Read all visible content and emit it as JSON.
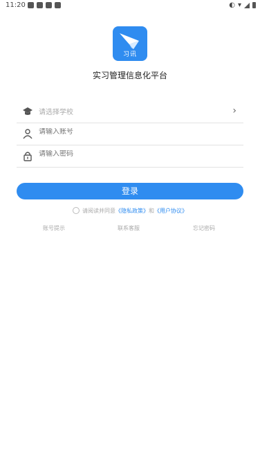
{
  "status": {
    "time": "11:20"
  },
  "app": {
    "logo_text": "习讯",
    "title": "实习管理信息化平台"
  },
  "form": {
    "school_placeholder": "请选择学校",
    "account_placeholder": "请输入账号",
    "password_placeholder": "请输入密码",
    "login_label": "登录"
  },
  "agreement": {
    "prefix": "请阅读并同意",
    "privacy": "《隐私政策》",
    "and": "和",
    "user_agreement": "《用户协议》"
  },
  "links": {
    "account_tip": "账号提示",
    "contact_support": "联系客服",
    "forgot_password": "忘记密码"
  },
  "colors": {
    "brand": "#2f8cf0"
  },
  "icons": [
    "graduation-cap-icon",
    "user-icon",
    "lock-icon",
    "chevron-right-icon"
  ]
}
